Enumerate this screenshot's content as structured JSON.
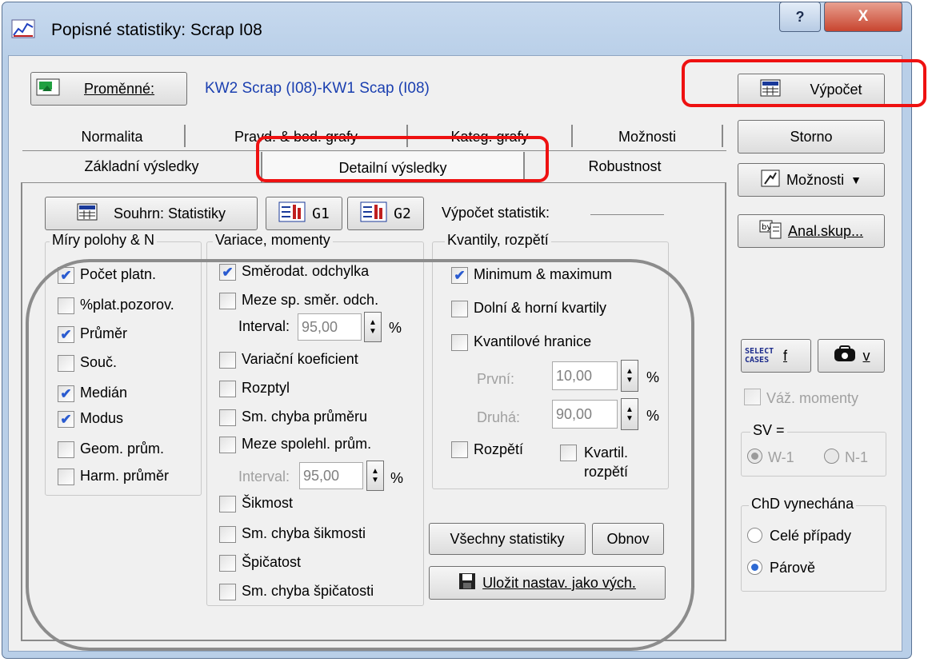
{
  "window": {
    "title": "Popisné statistiky: Scrap I08",
    "help_button": "?",
    "close_button": "X"
  },
  "variables": {
    "button_label": "Proměnné:",
    "value": "KW2 Scrap (I08)-KW1 Scap (I08)"
  },
  "side": {
    "compute": "Výpočet",
    "cancel": "Storno",
    "options": "Možnosti",
    "options_arrow": "▼",
    "by_group": "Anal.skup...",
    "select_cases_icon_text": "SELECT CASES",
    "select_cases_f": "f",
    "weight_v": "v",
    "weighted_moments": "Váž. momenty",
    "sv_label": "SV =",
    "sv_options": [
      "W-1",
      "N-1"
    ],
    "missing_title": "ChD vynechána",
    "missing_options": [
      "Celé případy",
      "Párově"
    ]
  },
  "tabs": {
    "row_back": [
      "Normalita",
      "Pravd. & bod. grafy",
      "Kateg. grafy",
      "Možnosti"
    ],
    "row_front": [
      "Základní výsledky",
      "Detailní výsledky",
      "Robustnost"
    ],
    "active": "Detailní výsledky"
  },
  "toolbar": {
    "summary": "Souhrn: Statistiky",
    "g1": "G1",
    "g2": "G2",
    "stat_calc_label": "Výpočet statistik:"
  },
  "location": {
    "title": "Míry polohy & N",
    "items": [
      {
        "label": "Počet platn.",
        "checked": true
      },
      {
        "label": "%plat.pozorov.",
        "checked": false
      },
      {
        "label": "Průměr",
        "checked": true
      },
      {
        "label": "Souč.",
        "checked": false
      },
      {
        "label": "Medián",
        "checked": true
      },
      {
        "label": "Modus",
        "checked": true
      },
      {
        "label": "Geom. prům.",
        "checked": false
      },
      {
        "label": "Harm. průměr",
        "checked": false
      }
    ]
  },
  "variation": {
    "title": "Variace, momenty",
    "items": [
      {
        "label": "Směrodat. odchylka",
        "checked": true
      },
      {
        "label": "Meze sp. směr. odch.",
        "checked": false
      },
      {
        "label": "Variační koeficient",
        "checked": false
      },
      {
        "label": "Rozptyl",
        "checked": false
      },
      {
        "label": "Sm. chyba průměru",
        "checked": false
      },
      {
        "label": "Meze spolehl. prům.",
        "checked": false
      },
      {
        "label": "Šikmost",
        "checked": false
      },
      {
        "label": "Sm. chyba šikmosti",
        "checked": false
      },
      {
        "label": "Špičatost",
        "checked": false
      },
      {
        "label": "Sm. chyba špičatosti",
        "checked": false
      }
    ],
    "interval_label": "Interval:",
    "interval1": "95,00",
    "interval2": "95,00",
    "percent": "%"
  },
  "quantiles": {
    "title": "Kvantily, rozpětí",
    "items": [
      {
        "label": "Minimum & maximum",
        "checked": true
      },
      {
        "label": "Dolní & horní kvartily",
        "checked": false
      },
      {
        "label": "Kvantilové hranice",
        "checked": false
      }
    ],
    "first_label": "První:",
    "first_value": "10,00",
    "second_label": "Druhá:",
    "second_value": "90,00",
    "percent": "%",
    "range": "Rozpětí",
    "quartile_range_1": "Kvartil.",
    "quartile_range_2": "rozpětí"
  },
  "actions": {
    "all_stats": "Všechny statistiky",
    "refresh": "Obnov",
    "save_default": "Uložit nastav. jako vých."
  },
  "colors": {
    "highlight": "#ee1111",
    "checkmark": "#2a5bd0",
    "link_text": "#1a3fb0"
  }
}
